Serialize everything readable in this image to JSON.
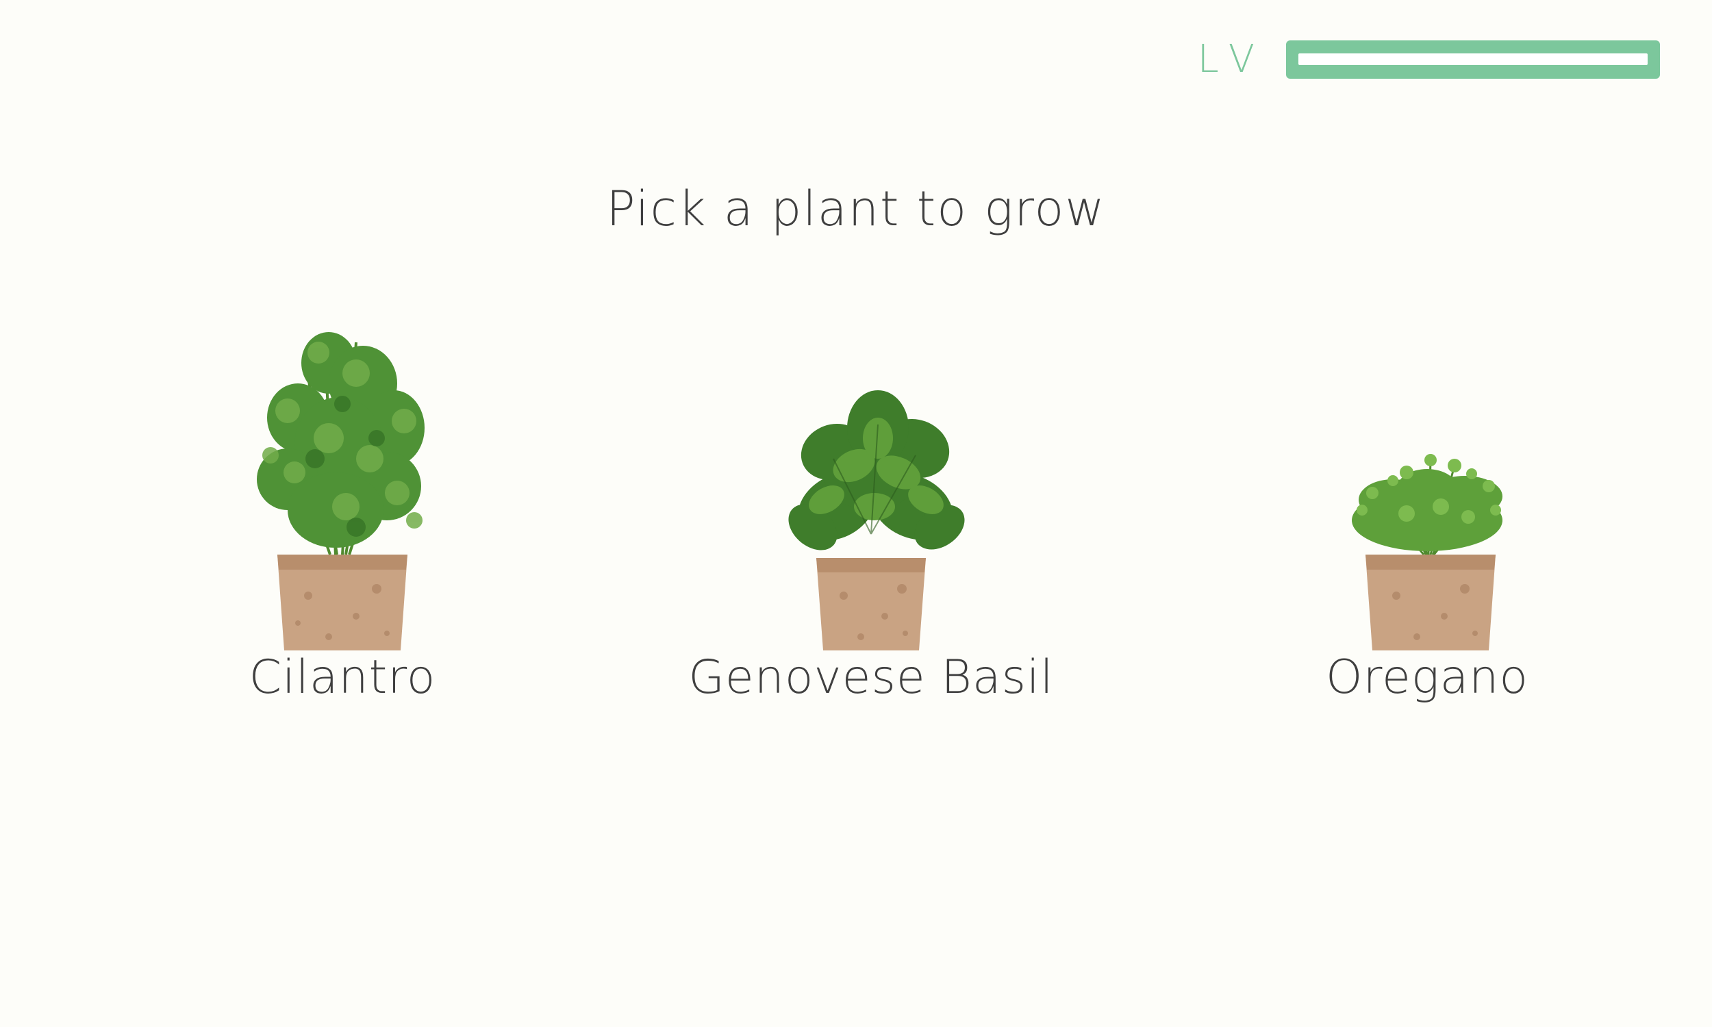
{
  "level": {
    "label": "LV",
    "progress": 1.0,
    "accent_color": "#7cc79c"
  },
  "title": "Pick a plant to grow",
  "plants": [
    {
      "name": "Cilantro",
      "icon": "cilantro-in-pot-icon"
    },
    {
      "name": "Genovese Basil",
      "icon": "basil-in-pot-icon"
    },
    {
      "name": "Oregano",
      "icon": "oregano-in-pot-icon"
    }
  ],
  "colors": {
    "background": "#fdfdf9",
    "text": "#3f3f3f",
    "pot": "#c9a383",
    "leaf_dark": "#3f7d2b",
    "leaf_light": "#6aa63b"
  }
}
